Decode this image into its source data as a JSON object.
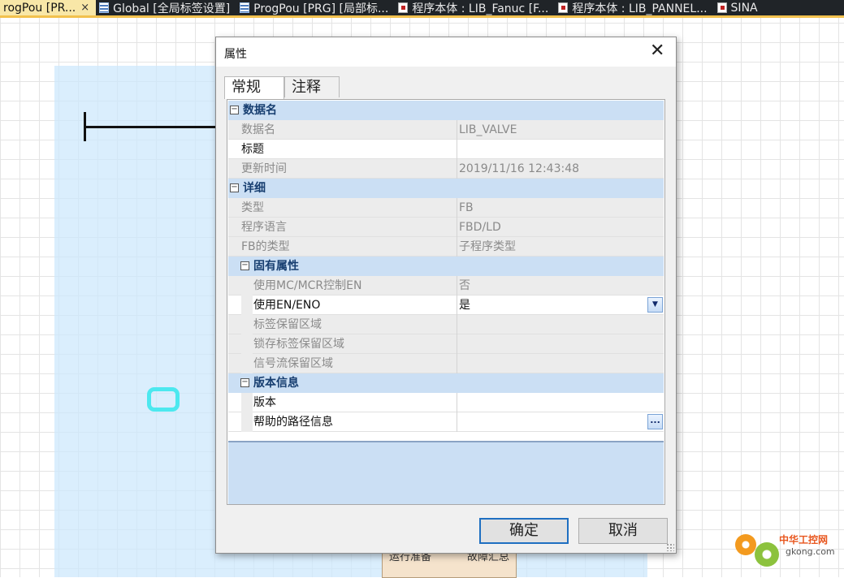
{
  "tabs": [
    {
      "label": "rogPou [PR...",
      "close": "×",
      "active": true,
      "icon": "none"
    },
    {
      "label": "Global [全局标签设置]",
      "active": false,
      "icon": "grid-icon"
    },
    {
      "label": "ProgPou [PRG] [局部标...",
      "active": false,
      "icon": "program-icon"
    },
    {
      "label": "程序本体 : LIB_Fanuc [F...",
      "active": false,
      "icon": "program-icon"
    },
    {
      "label": "程序本体 : LIB_PANNEL...",
      "active": false,
      "icon": "program-icon"
    },
    {
      "label": "SINA",
      "active": false,
      "icon": "program-icon"
    }
  ],
  "background": {
    "block_left_label": "运行准备",
    "block_right_label": "故障汇总"
  },
  "dialog": {
    "title": "属性",
    "close": "✕",
    "tabs": [
      "常规",
      "注释"
    ],
    "categories": {
      "dataname": {
        "toggle": "⊟",
        "label": "数据名"
      },
      "detail": {
        "toggle": "⊟",
        "label": "详细"
      },
      "inherent": {
        "toggle": "⊟",
        "label": "固有属性"
      },
      "version": {
        "toggle": "⊟",
        "label": "版本信息"
      }
    },
    "props": {
      "dataname": {
        "name": "数据名",
        "value": "LIB_VALVE"
      },
      "title": {
        "name": "标题",
        "value": ""
      },
      "update_time": {
        "name": "更新时间",
        "value": "2019/11/16 12:43:48"
      },
      "type": {
        "name": "类型",
        "value": "FB"
      },
      "lang": {
        "name": "程序语言",
        "value": "FBD/LD"
      },
      "fb_type": {
        "name": "FB的类型",
        "value": "子程序类型"
      },
      "use_mc": {
        "name": "使用MC/MCR控制EN",
        "value": "否"
      },
      "use_en": {
        "name": "使用EN/ENO",
        "value": "是"
      },
      "label_area": {
        "name": "标签保留区域",
        "value": ""
      },
      "latch_area": {
        "name": "锁存标签保留区域",
        "value": ""
      },
      "signal_area": {
        "name": "信号流保留区域",
        "value": ""
      },
      "version": {
        "name": "版本",
        "value": ""
      },
      "help_path": {
        "name": "帮助的路径信息",
        "value": ""
      }
    },
    "dropdown_glyph": "▼",
    "ellipsis_glyph": "...",
    "ok": "确定",
    "cancel": "取消"
  },
  "watermark": {
    "line1": "中华工控网",
    "line2": "gkong.com"
  },
  "colors": {
    "tabbar": "#202428",
    "active_tab": "#f8e7a7",
    "category_bg": "#cbdff4",
    "region": "#cde8fc",
    "cyan_shape": "#4ce8ef"
  }
}
